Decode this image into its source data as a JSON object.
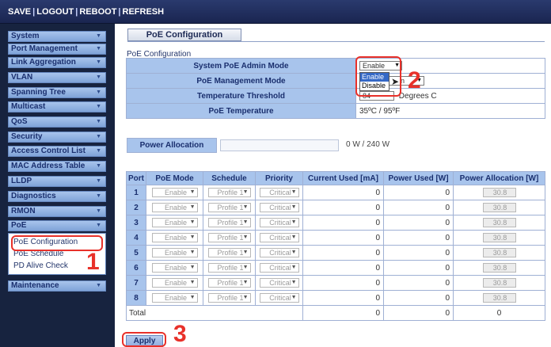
{
  "topbar": {
    "links": [
      {
        "name": "save",
        "label": "SAVE"
      },
      {
        "name": "logout",
        "label": "LOGOUT"
      },
      {
        "name": "reboot",
        "label": "REBOOT"
      },
      {
        "name": "refresh",
        "label": "REFRESH"
      }
    ],
    "separator": "|"
  },
  "sidebar": {
    "items": [
      {
        "name": "system",
        "label": "System"
      },
      {
        "name": "port-management",
        "label": "Port Management"
      },
      {
        "name": "link-aggregation",
        "label": "Link Aggregation"
      },
      {
        "name": "vlan",
        "label": "VLAN"
      },
      {
        "name": "spanning-tree",
        "label": "Spanning Tree"
      },
      {
        "name": "multicast",
        "label": "Multicast"
      },
      {
        "name": "qos",
        "label": "QoS"
      },
      {
        "name": "security",
        "label": "Security"
      },
      {
        "name": "access-control-list",
        "label": "Access Control List"
      },
      {
        "name": "mac-address-table",
        "label": "MAC Address Table"
      },
      {
        "name": "lldp",
        "label": "LLDP"
      },
      {
        "name": "diagnostics",
        "label": "Diagnostics"
      },
      {
        "name": "rmon",
        "label": "RMON"
      },
      {
        "name": "poe",
        "label": "PoE"
      }
    ],
    "poe_subitems": [
      {
        "name": "poe-configuration",
        "label": "PoE Configuration"
      },
      {
        "name": "poe-schedule",
        "label": "PoE Schedule"
      },
      {
        "name": "pd-alive-check",
        "label": "PD Alive Check"
      }
    ],
    "maintenance": {
      "label": "Maintenance"
    }
  },
  "main": {
    "page_title": "PoE Configuration",
    "section_label": "PoE Configuration",
    "config_rows": [
      {
        "name": "system-poe-admin-mode",
        "label": "System PoE Admin Mode",
        "value": "Enable"
      },
      {
        "name": "poe-management-mode",
        "label": "PoE Management Mode",
        "value": "n"
      },
      {
        "name": "temperature-threshold",
        "label": "Temperature Threshold",
        "value": "84",
        "unit": "Degrees C"
      },
      {
        "name": "poe-temperature",
        "label": "PoE Temperature",
        "value": "35ºC / 95ºF"
      }
    ],
    "admin_mode_dropdown": {
      "options": [
        "Enable",
        "Disable"
      ],
      "highlighted": "Enable"
    },
    "power_allocation": {
      "label": "Power Allocation",
      "value": "0 W / 240 W",
      "used_fraction": 0.0
    },
    "ports_table": {
      "headers": [
        "Port",
        "PoE Mode",
        "Schedule",
        "Priority",
        "Current Used [mA]",
        "Power Used [W]",
        "Power Allocation [W]"
      ],
      "rows": [
        {
          "port": "1",
          "mode": "Enable",
          "schedule": "Profile 1",
          "priority": "Critical",
          "current": "0",
          "power": "0",
          "alloc": "30.8"
        },
        {
          "port": "2",
          "mode": "Enable",
          "schedule": "Profile 1",
          "priority": "Critical",
          "current": "0",
          "power": "0",
          "alloc": "30.8"
        },
        {
          "port": "3",
          "mode": "Enable",
          "schedule": "Profile 1",
          "priority": "Critical",
          "current": "0",
          "power": "0",
          "alloc": "30.8"
        },
        {
          "port": "4",
          "mode": "Enable",
          "schedule": "Profile 1",
          "priority": "Critical",
          "current": "0",
          "power": "0",
          "alloc": "30.8"
        },
        {
          "port": "5",
          "mode": "Enable",
          "schedule": "Profile 1",
          "priority": "Critical",
          "current": "0",
          "power": "0",
          "alloc": "30.8"
        },
        {
          "port": "6",
          "mode": "Enable",
          "schedule": "Profile 1",
          "priority": "Critical",
          "current": "0",
          "power": "0",
          "alloc": "30.8"
        },
        {
          "port": "7",
          "mode": "Enable",
          "schedule": "Profile 1",
          "priority": "Critical",
          "current": "0",
          "power": "0",
          "alloc": "30.8"
        },
        {
          "port": "8",
          "mode": "Enable",
          "schedule": "Profile 1",
          "priority": "Critical",
          "current": "0",
          "power": "0",
          "alloc": "30.8"
        }
      ],
      "total": {
        "label": "Total",
        "current": "0",
        "power": "0",
        "alloc": "0"
      }
    },
    "apply_label": "Apply"
  },
  "annotations": {
    "step1": "1",
    "step2": "2",
    "step3": "3",
    "color": "#e8312a"
  },
  "colors": {
    "header_bg": "#a8c4ec",
    "sidebar_bg": "#17233f",
    "topbar_bg": "#1f2c5c",
    "text_blue": "#1a2f6e"
  }
}
